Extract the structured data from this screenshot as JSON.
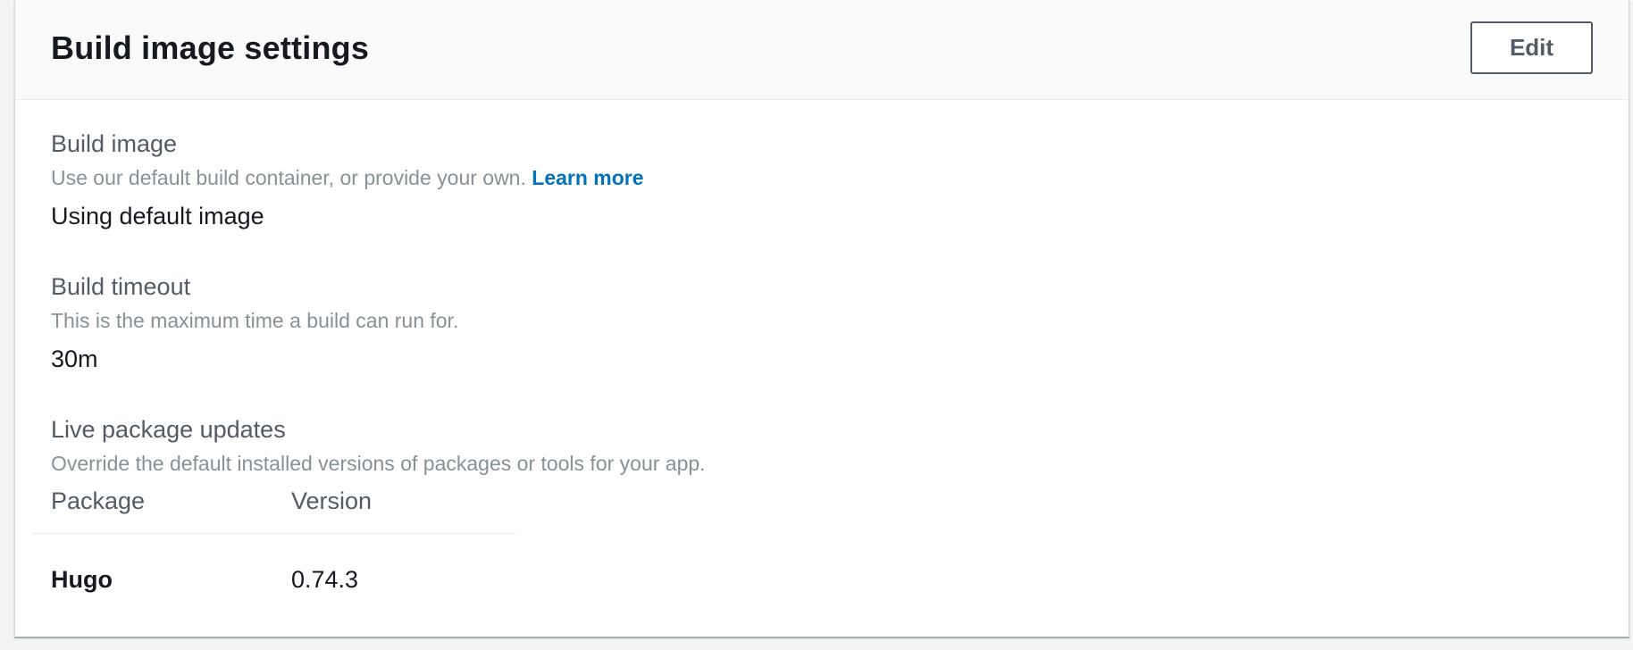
{
  "panel": {
    "title": "Build image settings",
    "edit_label": "Edit"
  },
  "build_image": {
    "label": "Build image",
    "description": "Use our default build container, or provide your own.",
    "learn_more": "Learn more",
    "value": "Using default image"
  },
  "build_timeout": {
    "label": "Build timeout",
    "description": "This is the maximum time a build can run for.",
    "value": "30m"
  },
  "live_updates": {
    "label": "Live package updates",
    "description": "Override the default installed versions of packages or tools for your app.",
    "columns": [
      "Package",
      "Version"
    ],
    "rows": [
      {
        "package": "Hugo",
        "version": "0.74.3"
      }
    ]
  },
  "colors": {
    "link": "#0073bb",
    "text": "#16191f",
    "label": "#545b64",
    "muted": "#879196"
  }
}
